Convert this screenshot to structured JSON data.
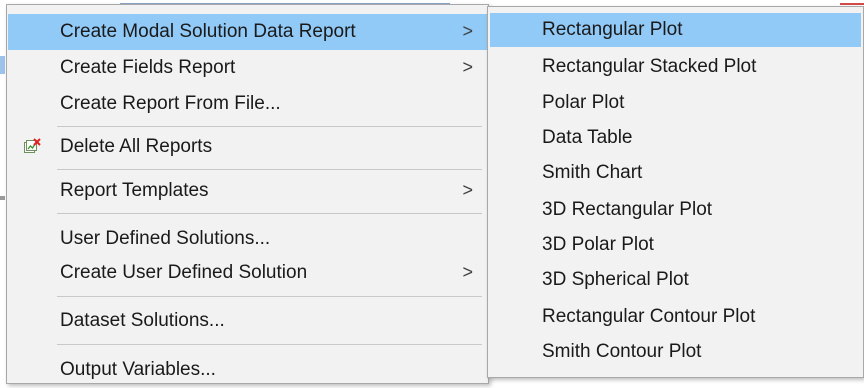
{
  "main_menu": {
    "items": [
      {
        "label": "Create Modal Solution Data Report",
        "has_submenu": true,
        "highlighted": true
      },
      {
        "label": "Create Fields Report",
        "has_submenu": true
      },
      {
        "label": "Create Report From File..."
      },
      {
        "label": "Delete All Reports",
        "icon": "delete-reports-icon"
      },
      {
        "label": "Report Templates",
        "has_submenu": true
      },
      {
        "label": "User Defined Solutions..."
      },
      {
        "label": "Create User Defined Solution",
        "has_submenu": true
      },
      {
        "label": "Dataset Solutions..."
      },
      {
        "label": "Output Variables..."
      }
    ],
    "submenu_arrow": ">"
  },
  "submenu": {
    "items": [
      {
        "label": "Rectangular Plot",
        "highlighted": true
      },
      {
        "label": "Rectangular Stacked Plot"
      },
      {
        "label": "Polar Plot"
      },
      {
        "label": "Data Table"
      },
      {
        "label": "Smith Chart"
      },
      {
        "label": "3D Rectangular Plot"
      },
      {
        "label": "3D Polar Plot"
      },
      {
        "label": "3D Spherical Plot"
      },
      {
        "label": "Rectangular Contour Plot"
      },
      {
        "label": "Smith Contour Plot"
      }
    ]
  },
  "colors": {
    "highlight": "#91c9f7",
    "menu_background": "#f2f2f2",
    "border": "#a8a8a8"
  }
}
